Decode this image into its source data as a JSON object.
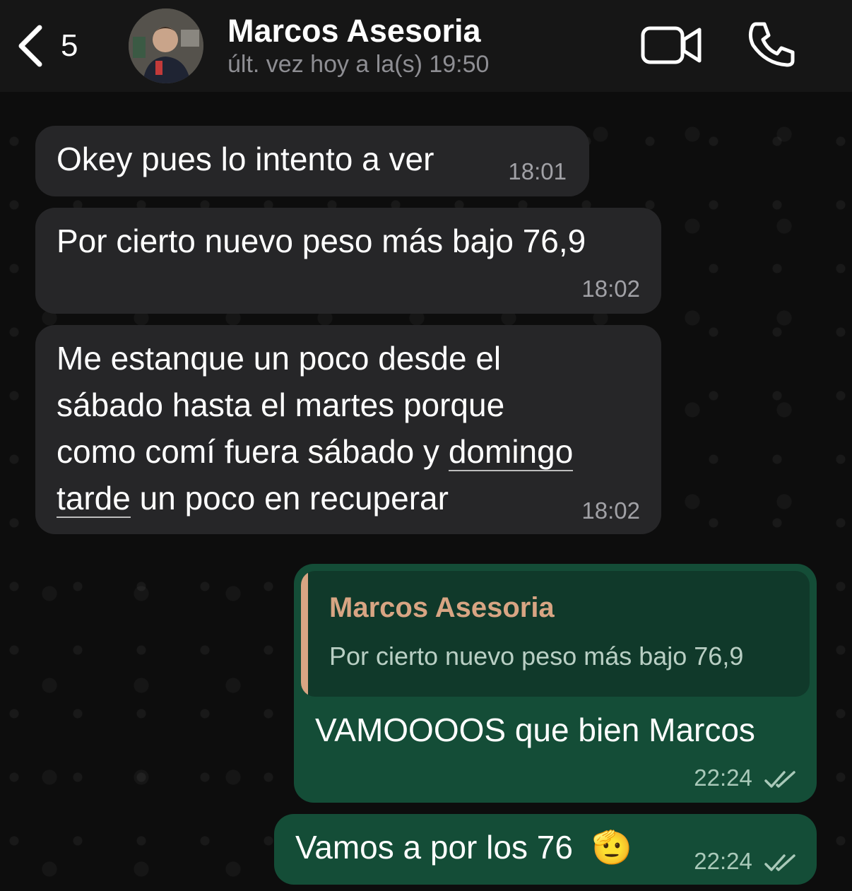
{
  "header": {
    "back_count": "5",
    "contact_name": "Marcos Asesoria",
    "last_seen": "últ. vez hoy a la(s) 19:50"
  },
  "messages": [
    {
      "direction": "incoming",
      "text": "Okey pues lo intento a ver",
      "time": "18:01"
    },
    {
      "direction": "incoming",
      "text": "Por cierto nuevo peso más bajo 76,9",
      "time": "18:02"
    },
    {
      "direction": "incoming",
      "lines": [
        "Me estanque un poco desde el",
        "sábado hasta el martes porque",
        "como comí fuera sábado y ",
        "domingo",
        "tarde",
        " un poco en recuperar"
      ],
      "time": "18:02"
    },
    {
      "direction": "outgoing",
      "quote": {
        "author": "Marcos Asesoria",
        "text": "Por cierto nuevo peso más bajo 76,9"
      },
      "text": "VAMOOOOS que bien Marcos",
      "time": "22:24",
      "status": "read"
    },
    {
      "direction": "outgoing",
      "text": "Vamos a por los 76",
      "emoji": "🫡",
      "time": "22:24",
      "status": "read"
    }
  ],
  "colors": {
    "incoming_bubble": "#262628",
    "outgoing_bubble": "#144d37",
    "quote_accent": "#d8a583",
    "header_bg": "#161616"
  }
}
